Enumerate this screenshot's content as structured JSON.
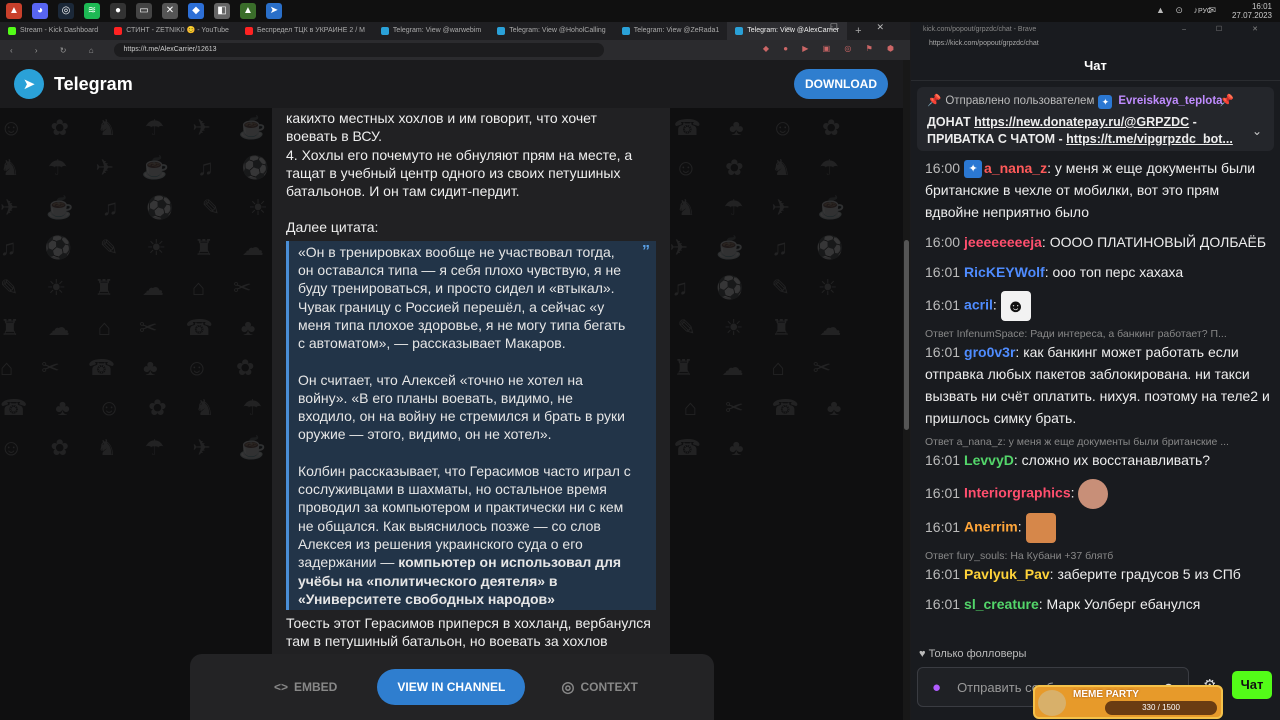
{
  "taskbar": {
    "tray": "▲ ⊙ ♪ ✉",
    "lang": "РУС",
    "time": "16:01",
    "date": "27.07.2023"
  },
  "browser": {
    "tabs": [
      {
        "label": "Stream - Kick Dashboard",
        "color": "#53fc18"
      },
      {
        "label": "СТИНТ - ZETNIK0 😊 - YouTube",
        "color": "#ff2222"
      },
      {
        "label": "Беспредел ТЦК в УКРАИНЕ 2 / М",
        "color": "#ff2222"
      },
      {
        "label": "Telegram: View @warwebim",
        "color": "#2aa1d8"
      },
      {
        "label": "Telegram: View @HoholCalling",
        "color": "#2aa1d8"
      },
      {
        "label": "Telegram: View @ZeRada1",
        "color": "#2aa1d8"
      },
      {
        "label": "Telegram: View @AlexCarrier",
        "color": "#2aa1d8"
      }
    ],
    "new_tab": "+",
    "window_controls": "– ☐ ✕",
    "nav_icons": "‹ › ↻ ⌂",
    "url": "https://t.me/AlexCarrier/12613",
    "ext_icons": "◆ ● ▶ ▣ ◎ ⚑ ⬢"
  },
  "telegram": {
    "brand": "Telegram",
    "download": "DOWNLOAD",
    "message": {
      "intro_lines": [
        "какихто местных хохлов и им говорит, что хочет",
        "воевать в ВСУ.",
        "4. Хохлы его почемуто не обнуляют прям на месте, а",
        "тащат в учебный центр одного из своих петушиных",
        "батальонов. И он там сидит-пердит."
      ],
      "lead": "Далее цитата:",
      "quote_p1": "«Он в тренировках вообще не участвовал тогда, он оставался типа — я себя плохо чувствую, я не буду тренироваться, и просто сидел и «втыкал». Чувак границу с Россией перешёл, а сейчас «у меня типа плохое здоровье, я не могу типа бегать с автоматом», — рассказывает Макаров.",
      "quote_p2": "Он считает, что Алексей «точно не хотел на войну». «В его планы воевать, видимо, не входило, он на войну не стремился и брать в руки оружие — этого, видимо, он не хотел».",
      "quote_p3_plain": "Колбин рассказывает, что Герасимов часто играл с сослуживцами в шахматы, но остальное время проводил за компьютером и практически ни с кем не общался. Как выяснилось позже — со слов Алексея из решения украинского суда о его задержании — ",
      "quote_p3_bold": "компьютер он использовал для учёбы на «политического деятеля» в «Университете свободных народов»",
      "outro_lines": [
        "Тоесть этот Герасимов приперся в хохланд, вербанулся",
        "там в петушиный батальон, но воевать за хохлов"
      ]
    },
    "bottom": {
      "embed": "EMBED",
      "view": "VIEW IN CHANNEL",
      "context": "CONTEXT"
    }
  },
  "chat": {
    "window_title": "kick.com/popout/grpzdc/chat - Brave",
    "url": "https://kick.com/popout/grpzdc/chat",
    "header": "Чат",
    "pinned": {
      "by_label": "Отправлено пользователем",
      "by_user": "Evreiskaya_teplota",
      "text_a": "ДОНАТ ",
      "link_a": "https://new.donatepay.ru/@GRPZDC",
      "text_b": " - ПРИВАТКА С ЧАТОМ - ",
      "link_b": "https://t.me/vipgrpzdc_bot..."
    },
    "messages": [
      {
        "time": "16:00",
        "user": "a_nana_z",
        "color": "#ff5a5a",
        "text": "у меня ж еще документы были британские в чехле от мобилки, вот это прям вдвойне неприятно было",
        "badge": true
      },
      {
        "time": "16:00",
        "user": "jeeeeeeeeja",
        "color": "#ff4f6e",
        "text": "ОООО ПЛАТИНОВЫЙ ДОЛБАЁБ"
      },
      {
        "time": "16:01",
        "user": "RicKEYWolf",
        "color": "#4f8cff",
        "text": "ооо топ перс хахаха"
      },
      {
        "time": "16:01",
        "user": "acril",
        "color": "#4f8cff",
        "text": "",
        "emote": "#f2f2f2"
      },
      {
        "reply": "Ответ InfenumSpace: Ради интереса, а банкинг работает? П...",
        "time": "16:01",
        "user": "gro0v3r",
        "color": "#4f8cff",
        "text": "как банкинг может работать если отправка любых пакетов заблокирована. ни такси вызвать ни счёт оплатить. нихуя. поэтому на теле2 и пришлось симку брать."
      },
      {
        "reply": "Ответ a_nana_z: у меня ж еще документы были британские ...",
        "time": "16:01",
        "user": "LevvyD",
        "color": "#53d66a",
        "text": "сложно их восстанавливать?"
      },
      {
        "time": "16:01",
        "user": "Interiorgraphics",
        "color": "#ff4f6e",
        "text": "",
        "emote": "#c88f78"
      },
      {
        "time": "16:01",
        "user": "Anerrim",
        "color": "#ffa63a",
        "text": "",
        "emote": "#d6874a"
      },
      {
        "reply": "Ответ fury_souls: На Кубани +37 блятб",
        "time": "16:01",
        "user": "Pavlyuk_Pav",
        "color": "#ffd33a",
        "text": "заберите градусов 5 из СПб"
      },
      {
        "time": "16:01",
        "user": "sl_creature",
        "color": "#53d66a",
        "text": "Марк Уолберг ебанулся"
      }
    ],
    "followers_only": "Только фолловеры",
    "input_placeholder": "Отправить сообщение",
    "send": "Чат"
  },
  "overlay": {
    "title": "MEME PARTY",
    "count": "330 / 1500"
  }
}
